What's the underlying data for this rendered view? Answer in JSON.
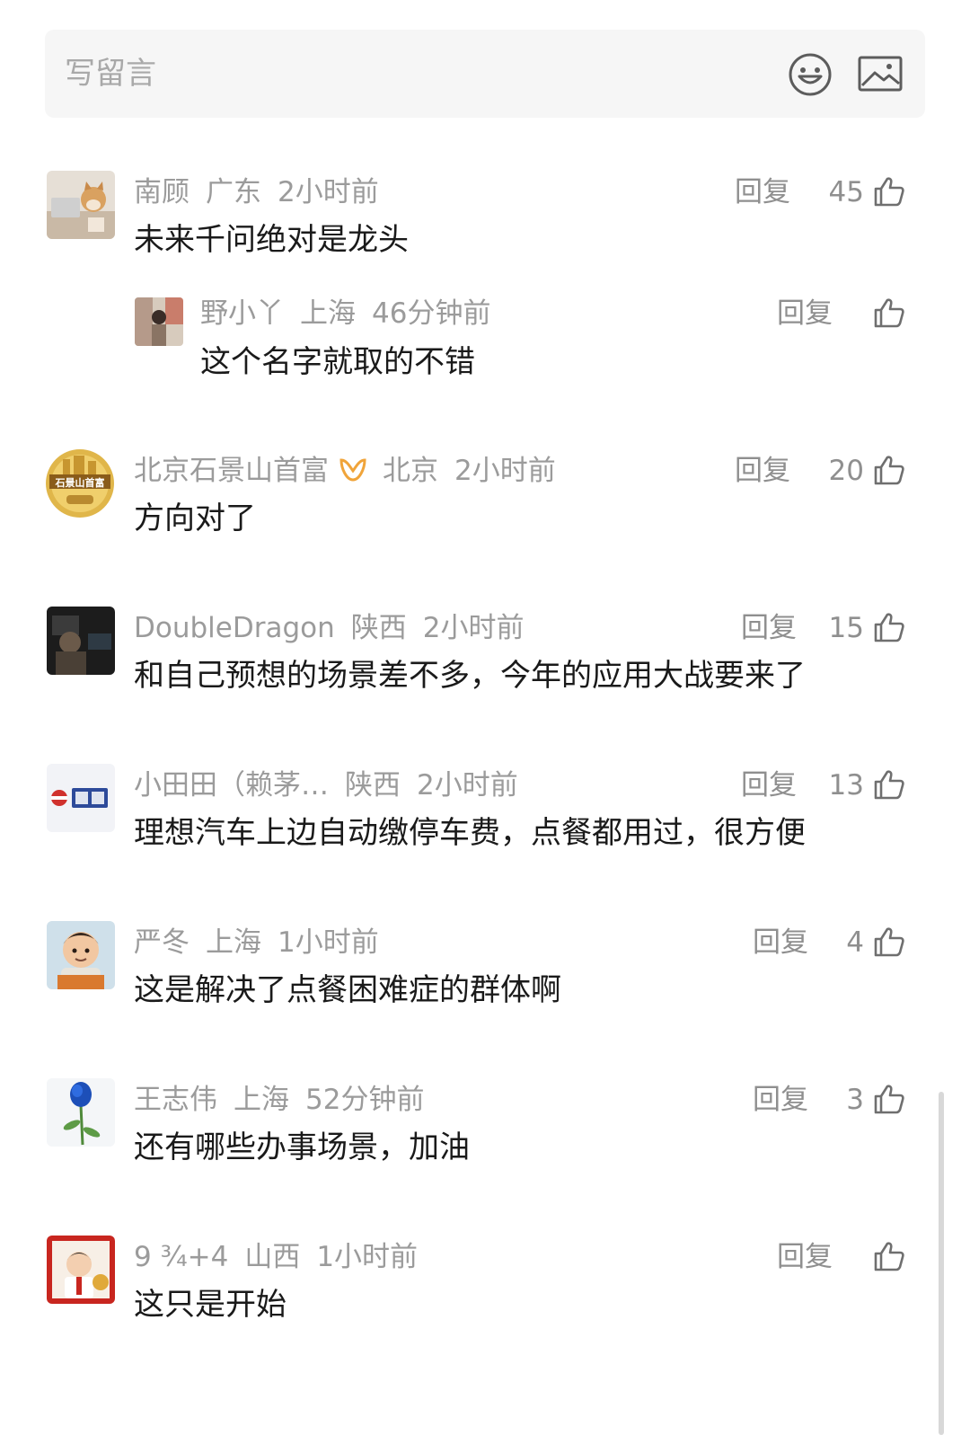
{
  "input": {
    "placeholder": "写留言"
  },
  "icons": {
    "emoji": "emoji-icon",
    "image": "image-icon",
    "like": "thumbs-up-icon"
  },
  "colors": {
    "meta": "#9b9b9b",
    "body": "#1a1a1a",
    "input_bg": "#f6f6f6"
  },
  "reply_label": "回复",
  "comments": [
    {
      "name": "南顾",
      "location": "广东",
      "time": "2小时前",
      "text": "未来千问绝对是龙头",
      "likes": "45"
    },
    {
      "name": "野小丫",
      "location": "上海",
      "time": "46分钟前",
      "text": "这个名字就取的不错",
      "likes": ""
    },
    {
      "name": "北京石景山首富",
      "location": "北京",
      "time": "2小时前",
      "text": "方向对了",
      "likes": "20"
    },
    {
      "name": "DoubleDragon",
      "location": "陕西",
      "time": "2小时前",
      "text": "和自己预想的场景差不多，今年的应用大战要来了",
      "likes": "15"
    },
    {
      "name": "小田田（赖茅…",
      "location": "陕西",
      "time": "2小时前",
      "text": "理想汽车上边自动缴停车费，点餐都用过，很方便",
      "likes": "13"
    },
    {
      "name": "严冬",
      "location": "上海",
      "time": "1小时前",
      "text": "这是解决了点餐困难症的群体啊",
      "likes": "4"
    },
    {
      "name": "王志伟",
      "location": "上海",
      "time": "52分钟前",
      "text": "还有哪些办事场景，加油",
      "likes": "3"
    },
    {
      "name": "9 ¾+4",
      "location": "山西",
      "time": "1小时前",
      "text": "这只是开始",
      "likes": ""
    }
  ]
}
